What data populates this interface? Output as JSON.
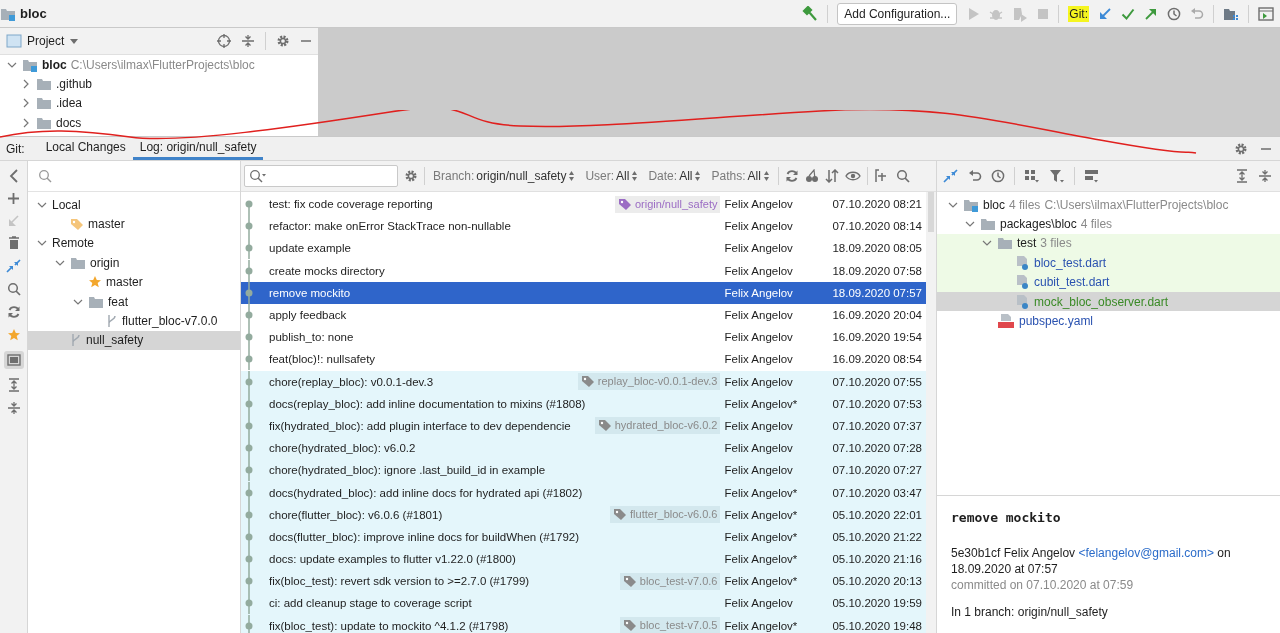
{
  "title_bar": {
    "project": "bloc",
    "run_config": "Add Configuration...",
    "vcs_label": "Git:"
  },
  "project_panel": {
    "title": "Project",
    "tree": [
      {
        "name": "bloc",
        "path": "C:\\Users\\ilmax\\FlutterProjects\\bloc",
        "kind": "module",
        "expanded": true,
        "children": [
          {
            "name": ".github",
            "kind": "folder",
            "expanded": false
          },
          {
            "name": ".idea",
            "kind": "folder",
            "expanded": false
          },
          {
            "name": "docs",
            "kind": "folder",
            "expanded": false
          }
        ]
      }
    ]
  },
  "git_tabs": {
    "label": "Git:",
    "tabs": [
      {
        "label": "Local Changes",
        "selected": false
      },
      {
        "label": "Log: origin/null_safety",
        "selected": true
      }
    ]
  },
  "branches": {
    "tree": [
      {
        "name": "Local",
        "expanded": true,
        "selected": false,
        "children": [
          {
            "name": "master",
            "kind": "tag",
            "selected": false
          }
        ]
      },
      {
        "name": "Remote",
        "expanded": true,
        "selected": false,
        "children": [
          {
            "name": "origin",
            "kind": "folder",
            "expanded": true,
            "selected": false,
            "children": [
              {
                "name": "master",
                "kind": "favorite",
                "selected": false
              },
              {
                "name": "feat",
                "kind": "folder",
                "expanded": true,
                "selected": false,
                "children": [
                  {
                    "name": "flutter_bloc-v7.0.0",
                    "kind": "branch",
                    "selected": false
                  }
                ]
              }
            ]
          },
          {
            "name": "null_safety",
            "kind": "branch",
            "selected": true
          }
        ]
      }
    ]
  },
  "log": {
    "filters": [
      {
        "label": "Branch:",
        "value": "origin/null_safety"
      },
      {
        "label": "User:",
        "value": "All"
      },
      {
        "label": "Date:",
        "value": "All"
      },
      {
        "label": "Paths:",
        "value": "All"
      }
    ],
    "commits": [
      {
        "message": "test: fix code coverage reporting",
        "tag": {
          "label": "origin/null_safety",
          "color": "#9b6cc4"
        },
        "author": "Felix Angelov",
        "date": "07.10.2020 08:21",
        "selected": false,
        "highlighted": false
      },
      {
        "message": "refactor: make onError StackTrace non-nullable",
        "author": "Felix Angelov",
        "date": "07.10.2020 08:14",
        "selected": false,
        "highlighted": false
      },
      {
        "message": "update example",
        "author": "Felix Angelov",
        "date": "18.09.2020 08:05",
        "selected": false,
        "highlighted": false
      },
      {
        "message": "create mocks directory",
        "author": "Felix Angelov",
        "date": "18.09.2020 07:58",
        "selected": false,
        "highlighted": false
      },
      {
        "message": "remove mockito",
        "author": "Felix Angelov",
        "date": "18.09.2020 07:57",
        "selected": true,
        "highlighted": false
      },
      {
        "message": "apply feedback",
        "author": "Felix Angelov",
        "date": "16.09.2020 20:04",
        "selected": false,
        "highlighted": false
      },
      {
        "message": "publish_to: none",
        "author": "Felix Angelov",
        "date": "16.09.2020 19:54",
        "selected": false,
        "highlighted": false
      },
      {
        "message": "feat(bloc)!: nullsafety",
        "author": "Felix Angelov",
        "date": "16.09.2020 08:54",
        "selected": false,
        "highlighted": false
      },
      {
        "message": "chore(replay_bloc): v0.0.1-dev.3",
        "tag": {
          "label": "replay_bloc-v0.0.1-dev.3",
          "color": "#8a8a8a"
        },
        "author": "Felix Angelov",
        "date": "07.10.2020 07:55",
        "selected": false,
        "highlighted": true
      },
      {
        "message": "docs(replay_bloc): add inline documentation to mixins (#1808)",
        "author": "Felix Angelov*",
        "date": "07.10.2020 07:53",
        "selected": false,
        "highlighted": true
      },
      {
        "message": "fix(hydrated_bloc): add plugin interface to dev dependencie",
        "tag": {
          "label": "hydrated_bloc-v6.0.2",
          "color": "#8a8a8a"
        },
        "author": "Felix Angelov",
        "date": "07.10.2020 07:37",
        "selected": false,
        "highlighted": true
      },
      {
        "message": "chore(hydrated_bloc): v6.0.2",
        "author": "Felix Angelov",
        "date": "07.10.2020 07:28",
        "selected": false,
        "highlighted": true
      },
      {
        "message": "chore(hydrated_bloc): ignore .last_build_id in example",
        "author": "Felix Angelov",
        "date": "07.10.2020 07:27",
        "selected": false,
        "highlighted": true
      },
      {
        "message": "docs(hydrated_bloc): add inline docs for hydrated api (#1802)",
        "author": "Felix Angelov*",
        "date": "07.10.2020 03:47",
        "selected": false,
        "highlighted": true
      },
      {
        "message": "chore(flutter_bloc): v6.0.6 (#1801)",
        "tag": {
          "label": "flutter_bloc-v6.0.6",
          "color": "#8a8a8a"
        },
        "author": "Felix Angelov*",
        "date": "05.10.2020 22:01",
        "selected": false,
        "highlighted": true
      },
      {
        "message": "docs(flutter_bloc): improve inline docs for buildWhen (#1792)",
        "author": "Felix Angelov*",
        "date": "05.10.2020 21:22",
        "selected": false,
        "highlighted": true
      },
      {
        "message": "docs: update examples to flutter v1.22.0 (#1800)",
        "author": "Felix Angelov*",
        "date": "05.10.2020 21:16",
        "selected": false,
        "highlighted": true
      },
      {
        "message": "fix(bloc_test): revert sdk version to >=2.7.0 (#1799)",
        "tag": {
          "label": "bloc_test-v7.0.6",
          "color": "#8a8a8a"
        },
        "author": "Felix Angelov*",
        "date": "05.10.2020 20:13",
        "selected": false,
        "highlighted": true
      },
      {
        "message": "ci: add cleanup stage to coverage script",
        "author": "Felix Angelov",
        "date": "05.10.2020 19:59",
        "selected": false,
        "highlighted": true
      },
      {
        "message": "fix(bloc_test): update to mockito ^4.1.2 (#1798)",
        "tag": {
          "label": "bloc_test-v7.0.5",
          "color": "#8a8a8a"
        },
        "author": "Felix Angelov*",
        "date": "05.10.2020 19:48",
        "selected": false,
        "highlighted": true
      }
    ]
  },
  "changes": {
    "tree": [
      {
        "name": "bloc",
        "count": "4 files",
        "path": "C:\\Users\\ilmax\\FlutterProjects\\bloc",
        "kind": "module",
        "expanded": true,
        "selected": false,
        "highlighted": false,
        "children": [
          {
            "name": "packages\\bloc",
            "count": "4 files",
            "kind": "folder",
            "expanded": true,
            "selected": false,
            "highlighted": false,
            "children": [
              {
                "name": "test",
                "count": "3 files",
                "kind": "folder",
                "expanded": true,
                "selected": false,
                "highlighted": true,
                "children": [
                  {
                    "name": "bloc_test.dart",
                    "kind": "dart",
                    "color": "#2a52b0",
                    "selected": false,
                    "highlighted": true
                  },
                  {
                    "name": "cubit_test.dart",
                    "kind": "dart",
                    "color": "#2a52b0",
                    "selected": false,
                    "highlighted": true
                  },
                  {
                    "name": "mock_bloc_observer.dart",
                    "kind": "dart",
                    "color": "#3a8a26",
                    "selected": true,
                    "highlighted": true
                  }
                ]
              },
              {
                "name": "pubspec.yaml",
                "kind": "yaml",
                "color": "#2a52b0",
                "selected": false,
                "highlighted": false
              }
            ]
          }
        ]
      }
    ]
  },
  "details": {
    "subject": "remove mockito",
    "hash_author": "5e30b1cf Felix Angelov",
    "email": "<felangelov@gmail.com>",
    "authored": "on 18.09.2020 at 07:57",
    "committed": "committed on 07.10.2020 at 07:59",
    "branches": "In 1 branch: origin/null_safety"
  }
}
